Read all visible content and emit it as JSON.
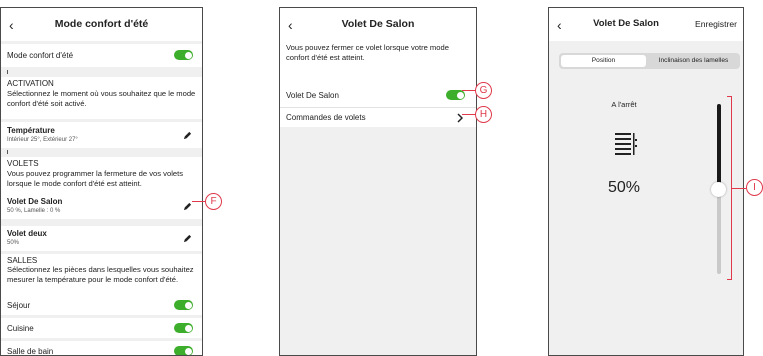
{
  "screen1": {
    "title": "Mode confort d'été",
    "toggle_label": "Mode confort d'été",
    "activation": {
      "heading": "ACTIVATION",
      "text": "Sélectionnez le moment où vous souhaitez que le mode confort d'été soit activé."
    },
    "temperature": {
      "label": "Température",
      "sub": "Intérieur 25°, Extérieur 27°"
    },
    "volets": {
      "heading": "VOLETS",
      "text": "Vous pouvez programmer la fermeture de vos volets lorsque le mode confort d'été est atteint."
    },
    "volet_salon": {
      "label": "Volet De Salon",
      "sub": "50 %, Lamelle : 0 %"
    },
    "volet_deux": {
      "label": "Volet deux",
      "sub": "50%"
    },
    "salles": {
      "heading": "SALLES",
      "text": "Sélectionnez les pièces dans lesquelles vous souhaitez mesurer la température pour le mode confort d'été."
    },
    "rooms": [
      "Séjour",
      "Cuisine",
      "Salle de bain"
    ]
  },
  "screen2": {
    "title": "Volet De Salon",
    "description": "Vous pouvez fermer ce volet lorsque votre mode confort d'été est atteint.",
    "toggle_label": "Volet De Salon",
    "commands_label": "Commandes de volets"
  },
  "screen3": {
    "title": "Volet De Salon",
    "save_label": "Enregistrer",
    "tabs": [
      "Position",
      "Inclinaison des lamelles"
    ],
    "active_tab": "Position",
    "status": "A l'arrêt",
    "position_value": "50%",
    "position_fraction": 0.5
  },
  "callouts": {
    "f": "F",
    "g": "G",
    "h": "H",
    "i": "I"
  },
  "colors": {
    "toggle_on": "#3dae2b",
    "callout": "#e0394b"
  }
}
